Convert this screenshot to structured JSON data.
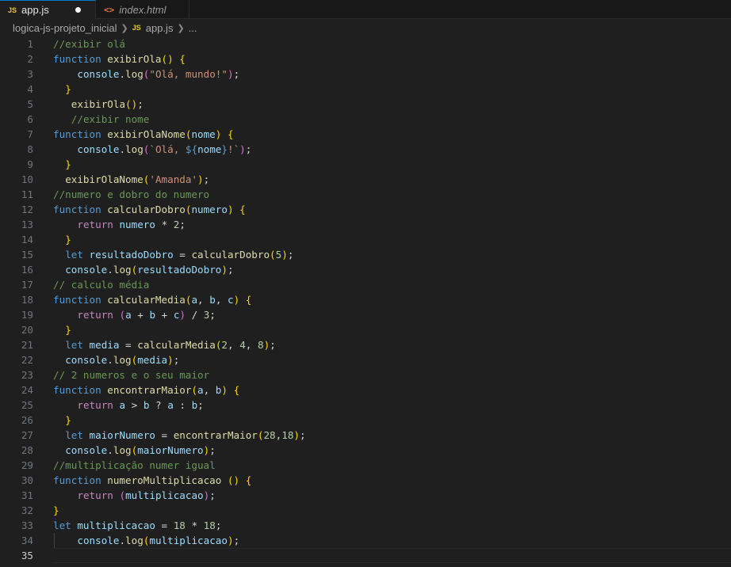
{
  "tabs": [
    {
      "label": "app.js",
      "icon": "JS",
      "modified": true,
      "active": true
    },
    {
      "label": "index.html",
      "icon": "<>",
      "active": false
    }
  ],
  "breadcrumb": {
    "folder": "logica-js-projeto_inicial",
    "file_icon": "JS",
    "file": "app.js",
    "more": "..."
  },
  "editor": {
    "language": "javascript",
    "current_line": 35,
    "lines": [
      "//exibir olá",
      "function exibirOla() {",
      "    console.log(\"Olá, mundo!\");",
      "  }",
      "   exibirOla();",
      "   //exibir nome",
      "function exibirOlaNome(nome) {",
      "    console.log(`Olá, ${nome}!`);",
      "  }",
      "  exibirOlaNome('Amanda');",
      "//numero e dobro do numero",
      "function calcularDobro(numero) {",
      "    return numero * 2;",
      "  }",
      "  let resultadoDobro = calcularDobro(5);",
      "  console.log(resultadoDobro);",
      "// calculo média",
      "function calcularMedia(a, b, c) {",
      "    return (a + b + c) / 3;",
      "  }",
      "  let media = calcularMedia(2, 4, 8);",
      "  console.log(media);",
      "// 2 numeros e o seu maior",
      "function encontrarMaior(a, b) {",
      "    return a > b ? a : b;",
      "  }",
      "  let maiorNumero = encontrarMaior(28,18);",
      "  console.log(maiorNumero);",
      "//multiplicação numer igual",
      "function numeroMultiplicacao () {",
      "    return (multiplicacao);",
      "}",
      "let multiplicacao = 18 * 18;",
      "    console.log(multiplicacao);",
      ""
    ]
  }
}
